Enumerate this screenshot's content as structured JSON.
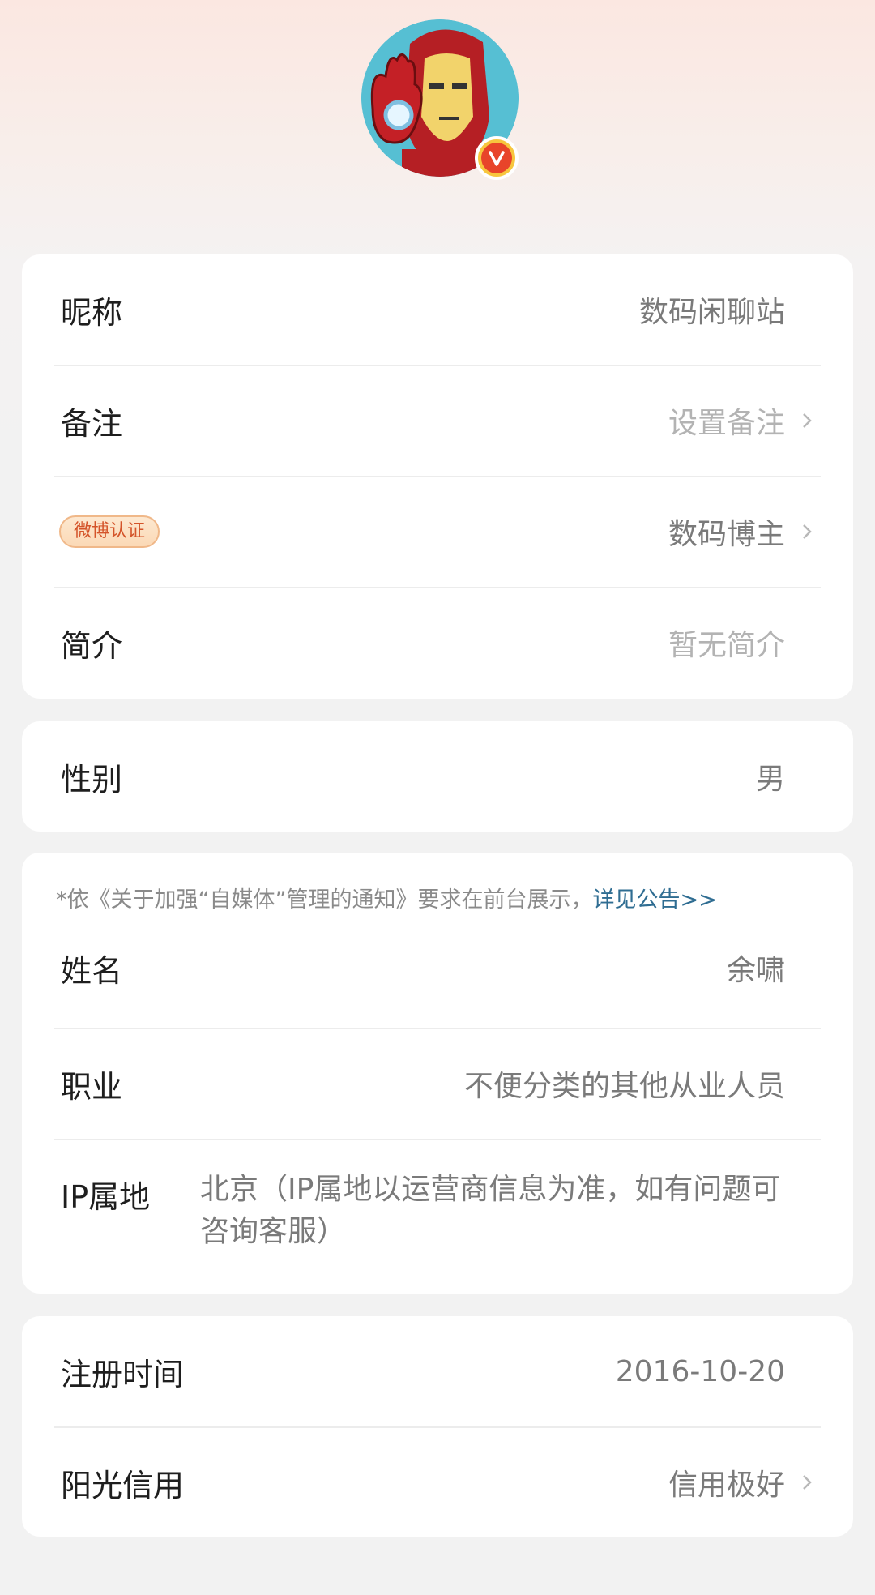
{
  "profile": {
    "avatar_icon": "iron-man-avatar",
    "verified_icon": "verified-v-icon"
  },
  "card1": {
    "nickname": {
      "label": "昵称",
      "value": "数码闲聊站"
    },
    "remark": {
      "label": "备注",
      "value": "设置备注"
    },
    "certification": {
      "badge": "微博认证",
      "value": "数码博主"
    },
    "bio": {
      "label": "简介",
      "value": "暂无简介"
    }
  },
  "card2": {
    "gender": {
      "label": "性别",
      "value": "男"
    }
  },
  "card3": {
    "notice_text": "*依《关于加强“自媒体”管理的通知》要求在前台展示，",
    "notice_link": "详见公告>>",
    "name": {
      "label": "姓名",
      "value": "余啸"
    },
    "occupation": {
      "label": "职业",
      "value": "不便分类的其他从业人员"
    },
    "ip_location": {
      "label": "IP属地",
      "value": "北京（IP属地以运营商信息为准，如有问题可咨询客服）"
    }
  },
  "card4": {
    "register_time": {
      "label": "注册时间",
      "value": "2016-10-20"
    },
    "sunshine_credit": {
      "label": "阳光信用",
      "value": "信用极好"
    }
  },
  "colors": {
    "link": "#2f6d92",
    "badge_text": "#d4542a",
    "verified": "#e8442a"
  }
}
